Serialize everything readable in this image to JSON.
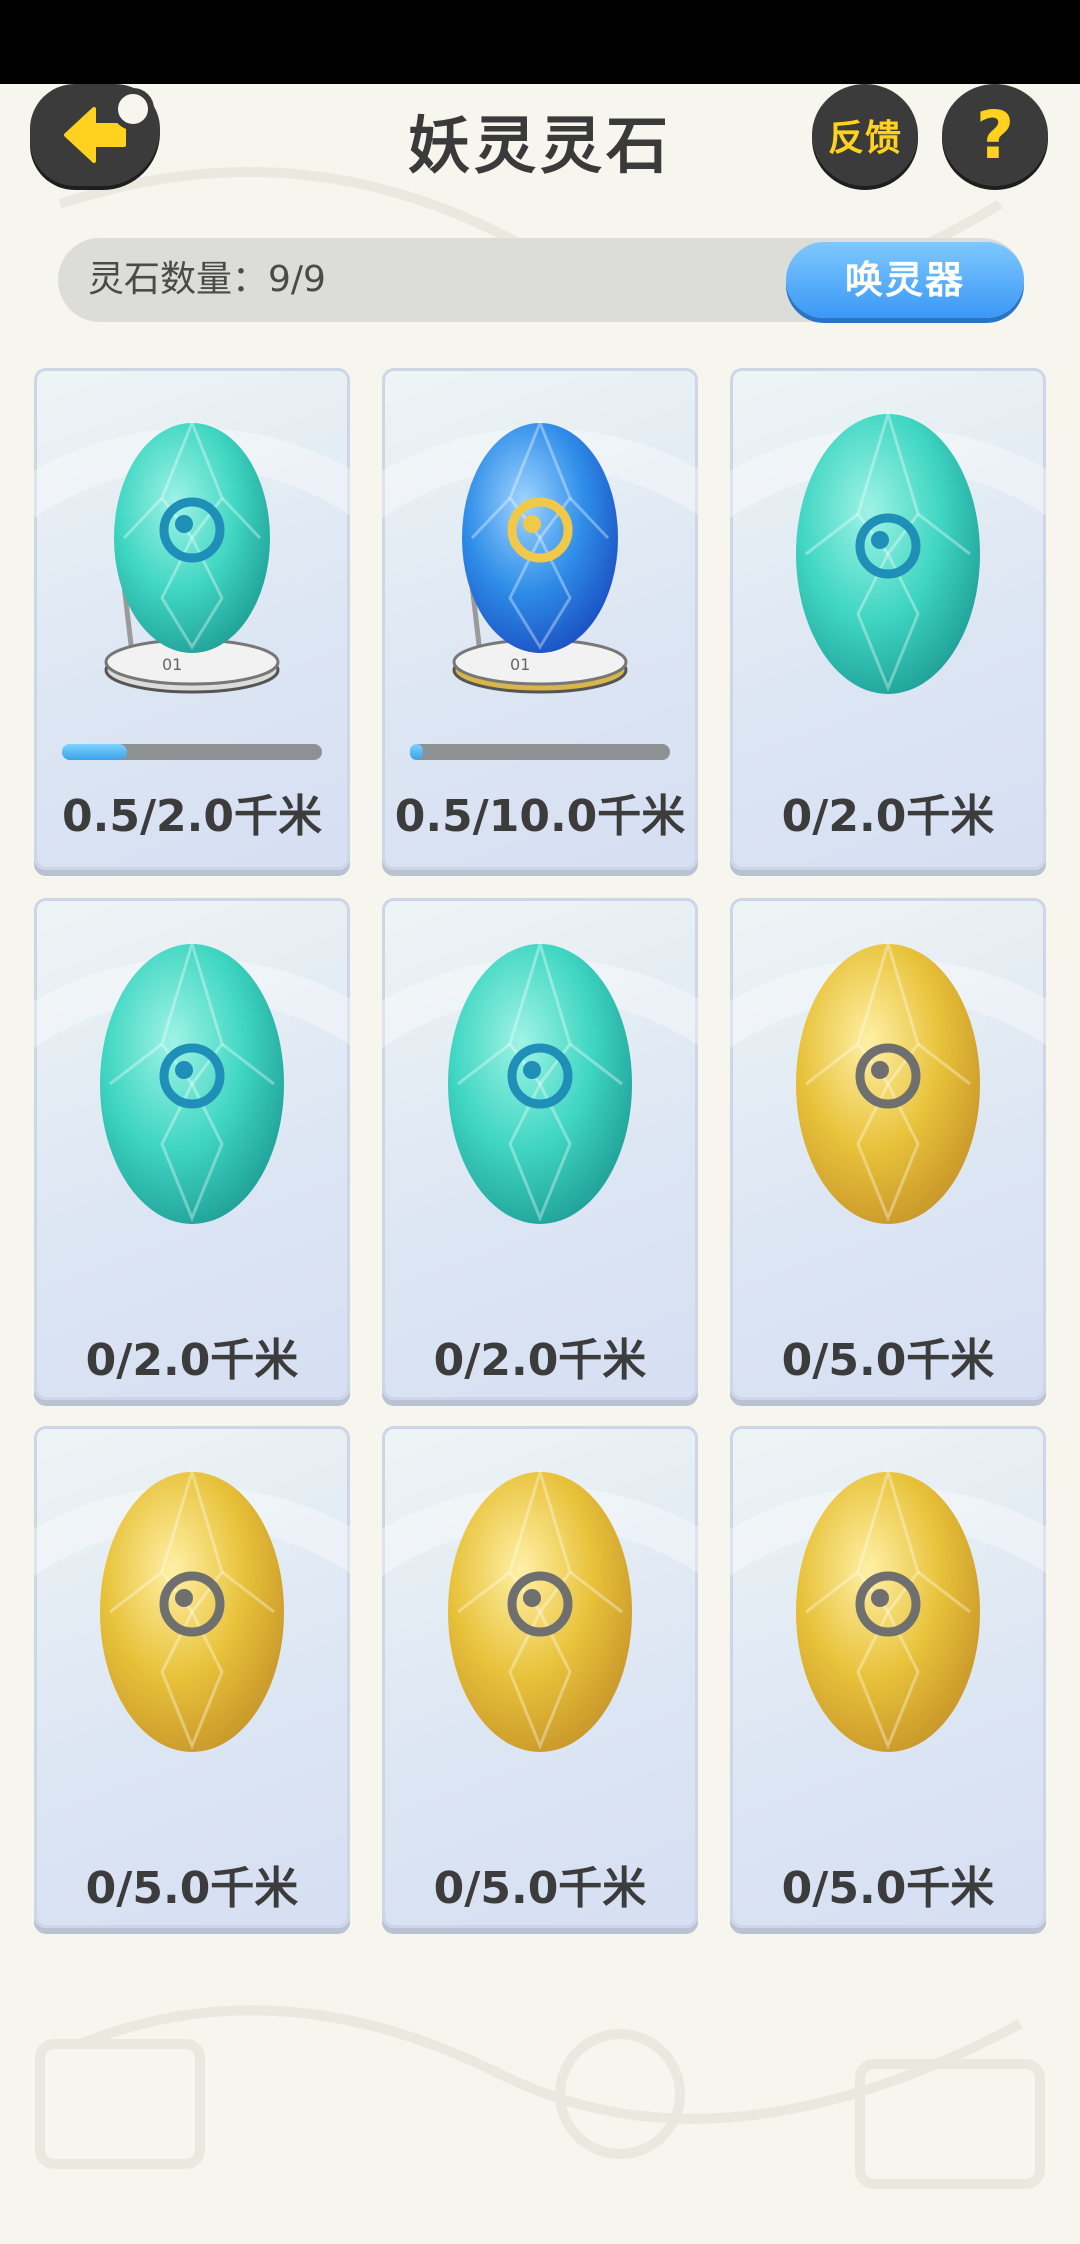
{
  "header": {
    "title": "妖灵灵石",
    "feedback_label": "反馈",
    "help_symbol": "?"
  },
  "count_bar": {
    "label": "灵石数量：9/9",
    "summon_button": "唤灵器"
  },
  "stones": [
    {
      "color": "teal",
      "incubating": true,
      "label": "0.5/2.0千米",
      "progress": 0.25
    },
    {
      "color": "blue",
      "incubating": true,
      "label": "0.5/10.0千米",
      "progress": 0.05
    },
    {
      "color": "teal",
      "incubating": false,
      "label": "0/2.0千米"
    },
    {
      "color": "teal",
      "incubating": false,
      "label": "0/2.0千米"
    },
    {
      "color": "teal",
      "incubating": false,
      "label": "0/2.0千米"
    },
    {
      "color": "gold",
      "incubating": false,
      "label": "0/5.0千米"
    },
    {
      "color": "gold",
      "incubating": false,
      "label": "0/5.0千米"
    },
    {
      "color": "gold",
      "incubating": false,
      "label": "0/5.0千米"
    },
    {
      "color": "gold",
      "incubating": false,
      "label": "0/5.0千米"
    }
  ],
  "colors": {
    "teal": "#3fd6c2",
    "blue": "#2f8de8",
    "gold": "#e8c23a",
    "accent_yellow": "#ffd21f",
    "button_dark": "#3b3b3b",
    "summon_blue": "#3b98f5"
  },
  "icons": [
    "back-arrow-icon",
    "question-mark-icon",
    "incubator-icon",
    "spirit-swirl-icon"
  ]
}
